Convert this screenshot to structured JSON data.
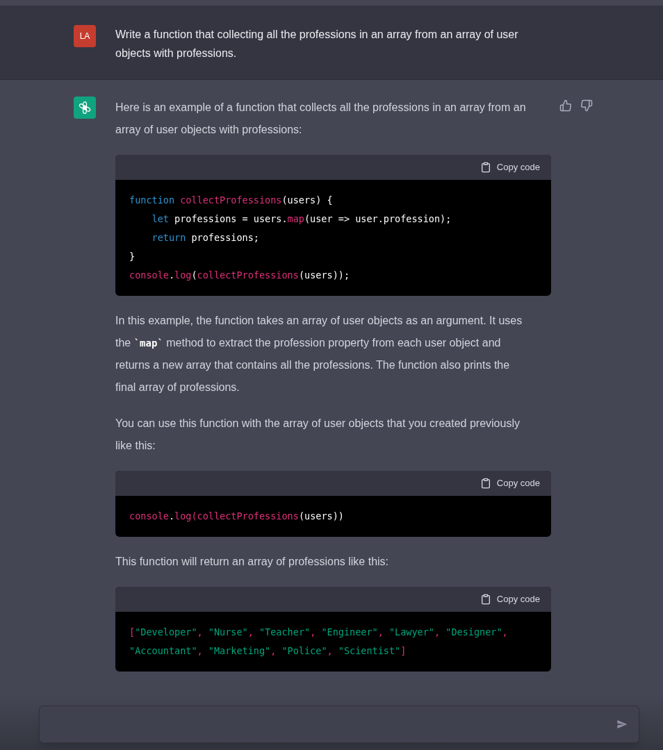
{
  "user_message": {
    "avatar": "LA",
    "text": "Write a function that collecting all the professions in an array from an array of user objects with professions."
  },
  "assistant_message": {
    "blocks": [
      {
        "kind": "paragraph",
        "parts": [
          {
            "text": "Here is an example of a function that collects all the professions in an array from an array of user objects with professions:"
          }
        ]
      },
      {
        "kind": "code",
        "copy_label": "Copy code",
        "lines": [
          [
            {
              "text": "function ",
              "kind": "keyword"
            },
            {
              "text": "collectProfessions",
              "kind": "func"
            },
            {
              "text": "(users) {",
              "kind": "plain"
            }
          ],
          [
            {
              "text": "    let ",
              "kind": "keyword"
            },
            {
              "text": "professions = users.",
              "kind": "plain"
            },
            {
              "text": "map",
              "kind": "func"
            },
            {
              "text": "(user => user.profession);",
              "kind": "plain"
            }
          ],
          [
            {
              "text": "    return ",
              "kind": "keyword"
            },
            {
              "text": "professions;",
              "kind": "plain"
            }
          ],
          [
            {
              "text": "}",
              "kind": "plain"
            }
          ],
          [
            {
              "text": "console",
              "kind": "func"
            },
            {
              "text": ".",
              "kind": "plain"
            },
            {
              "text": "log",
              "kind": "func"
            },
            {
              "text": "(",
              "kind": "plain"
            },
            {
              "text": "collectProfessions",
              "kind": "func"
            },
            {
              "text": "(users));",
              "kind": "plain"
            }
          ]
        ]
      },
      {
        "kind": "paragraph",
        "parts": [
          {
            "text": "In this example, the function takes an array of user objects as an argument. It uses the "
          },
          {
            "text": "`map`",
            "kind": "code"
          },
          {
            "text": " method to extract the profession property from each user object and returns a new array that contains all the professions. The function also prints the final array of professions."
          }
        ]
      },
      {
        "kind": "paragraph",
        "parts": [
          {
            "text": "You can use this function with the array of user objects that you created previously like this:"
          }
        ]
      },
      {
        "kind": "code",
        "copy_label": "Copy code",
        "lines": [
          [
            {
              "text": "console",
              "kind": "func"
            },
            {
              "text": ".",
              "kind": "plain"
            },
            {
              "text": "log",
              "kind": "func"
            },
            {
              "text": "(",
              "kind": "func"
            },
            {
              "text": "collectProfessions",
              "kind": "func"
            },
            {
              "text": "(users))",
              "kind": "plain"
            }
          ]
        ]
      },
      {
        "kind": "paragraph",
        "parts": [
          {
            "text": "This function will return an array of professions like this:"
          }
        ]
      },
      {
        "kind": "code",
        "copy_label": "Copy code",
        "lines": [
          [
            {
              "text": "[",
              "kind": "punct"
            },
            {
              "text": "\"Developer\"",
              "kind": "string"
            },
            {
              "text": ", ",
              "kind": "punct"
            },
            {
              "text": "\"Nurse\"",
              "kind": "string"
            },
            {
              "text": ", ",
              "kind": "punct"
            },
            {
              "text": "\"Teacher\"",
              "kind": "string"
            },
            {
              "text": ", ",
              "kind": "punct"
            },
            {
              "text": "\"Engineer\"",
              "kind": "string"
            },
            {
              "text": ", ",
              "kind": "punct"
            },
            {
              "text": "\"Lawyer\"",
              "kind": "string"
            },
            {
              "text": ", ",
              "kind": "punct"
            },
            {
              "text": "\"Designer\"",
              "kind": "string"
            },
            {
              "text": ",",
              "kind": "punct"
            }
          ],
          [
            {
              "text": "\"Accountant\"",
              "kind": "string"
            },
            {
              "text": ", ",
              "kind": "punct"
            },
            {
              "text": "\"Marketing\"",
              "kind": "string"
            },
            {
              "text": ", ",
              "kind": "punct"
            },
            {
              "text": "\"Police\"",
              "kind": "string"
            },
            {
              "text": ", ",
              "kind": "punct"
            },
            {
              "text": "\"Scientist\"",
              "kind": "string"
            },
            {
              "text": "]",
              "kind": "punct"
            }
          ]
        ]
      }
    ]
  }
}
